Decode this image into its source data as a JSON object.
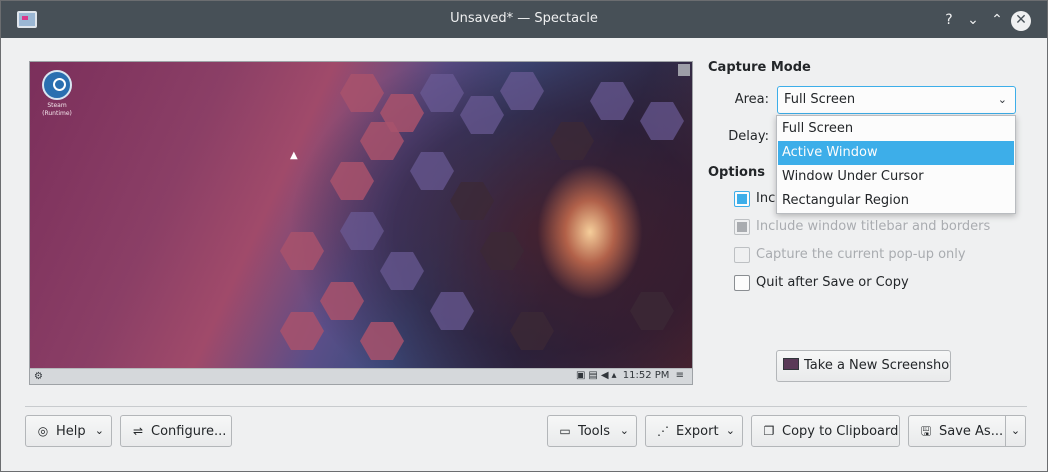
{
  "window": {
    "title": "Unsaved* — Spectacle",
    "controls": {
      "help": "?",
      "minimize": "⌄",
      "maximize": "⌃",
      "close": "✕"
    }
  },
  "preview": {
    "desktop_icon_label": "Steam (Runtime)",
    "clock": "11:52 PM"
  },
  "capture_mode": {
    "heading": "Capture Mode",
    "area_label": "Area:",
    "area_value": "Full Screen",
    "delay_label": "Delay:",
    "area_options": [
      "Full Screen",
      "Active Window",
      "Window Under Cursor",
      "Rectangular Region"
    ],
    "selected_option_index": 1
  },
  "options": {
    "heading": "Options",
    "items": [
      {
        "label": "Inc",
        "checked": true,
        "enabled": true
      },
      {
        "label": "Include window titlebar and borders",
        "checked": true,
        "enabled": false
      },
      {
        "label": "Capture the current pop-up only",
        "checked": false,
        "enabled": false
      },
      {
        "label": "Quit after Save or Copy",
        "checked": false,
        "enabled": true
      }
    ]
  },
  "buttons": {
    "new_screenshot": "Take a New Screenshot",
    "help": "Help",
    "configure": "Configure...",
    "tools": "Tools",
    "export": "Export",
    "copy_clipboard": "Copy to Clipboard",
    "save_as": "Save As..."
  },
  "colors": {
    "accent": "#3daee9",
    "titlebar": "#475057",
    "window_bg": "#eff0f1"
  }
}
